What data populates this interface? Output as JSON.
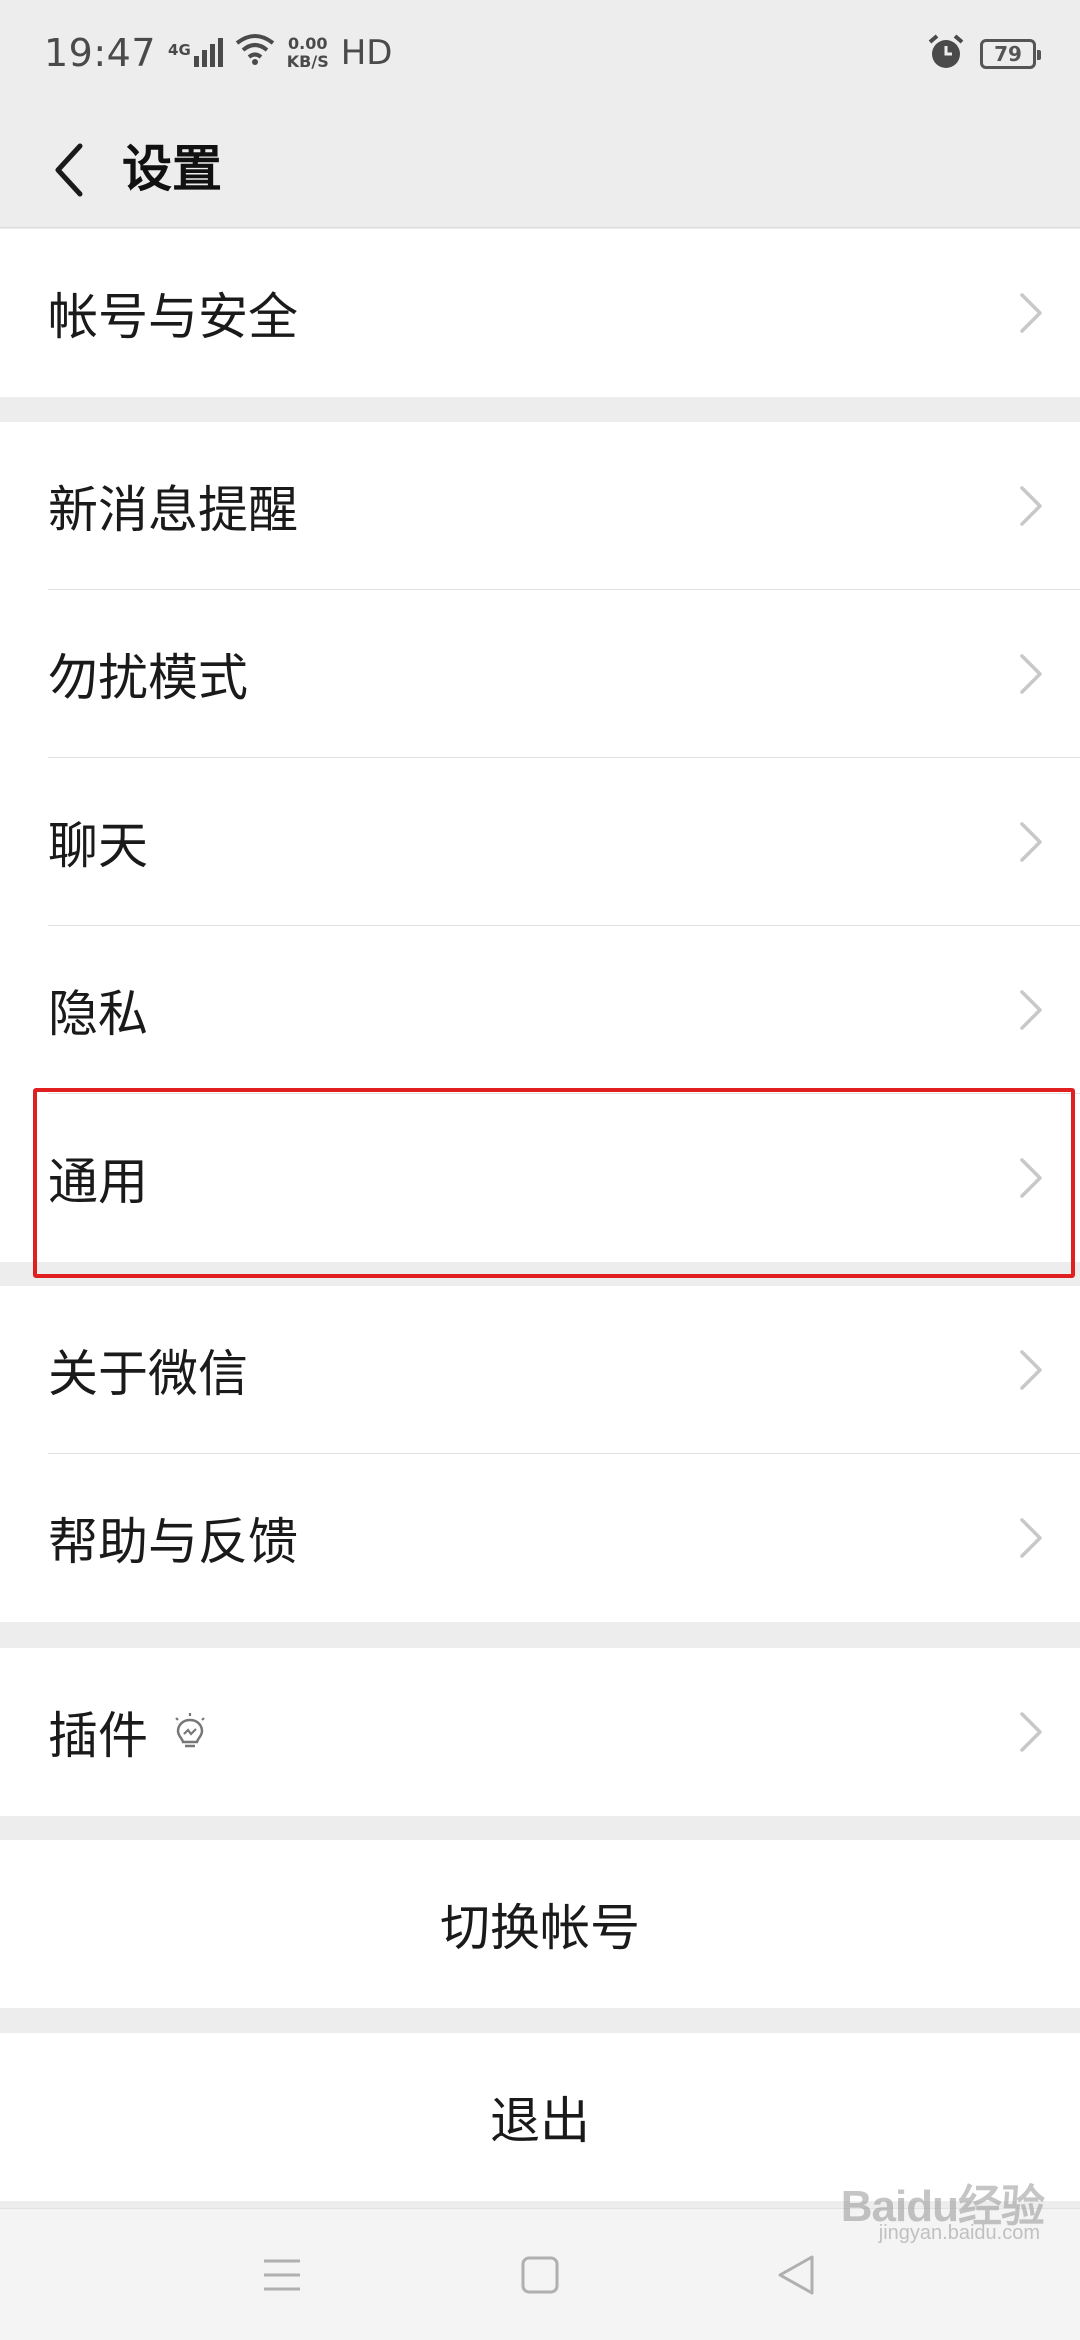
{
  "status_bar": {
    "time": "19:47",
    "network": "4G",
    "speed_value": "0.00",
    "speed_unit": "KB/S",
    "hd": "HD",
    "battery": "79"
  },
  "header": {
    "title": "设置"
  },
  "groups": {
    "account": [
      "帐号与安全"
    ],
    "settings": [
      "新消息提醒",
      "勿扰模式",
      "聊天",
      "隐私",
      "通用"
    ],
    "about": [
      "关于微信",
      "帮助与反馈"
    ],
    "plugins": "插件",
    "switch_account": "切换帐号",
    "logout": "退出"
  },
  "watermark": {
    "brand": "Baidu经验",
    "url": "jingyan.baidu.com"
  },
  "colors": {
    "background": "#ededed",
    "cell": "#ffffff",
    "highlight": "#e02020"
  }
}
